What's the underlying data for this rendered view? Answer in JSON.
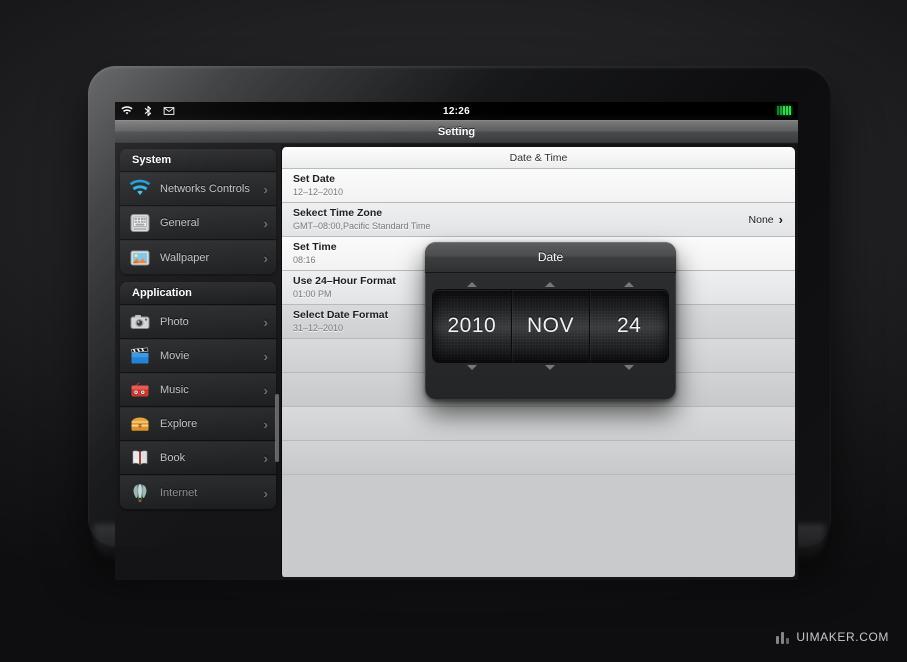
{
  "statusbar": {
    "icons": [
      "wifi-icon",
      "bluetooth-icon",
      "mail-icon"
    ],
    "time": "12:26",
    "battery_bars": 5
  },
  "titlebar": {
    "title": "Setting"
  },
  "sidebar": {
    "groups": [
      {
        "header": "System",
        "items": [
          {
            "label": "Networks Controls",
            "icon": "wifi-icon",
            "chevron": "›",
            "selected": false,
            "dim": false
          },
          {
            "label": "General",
            "icon": "general-settings-icon",
            "chevron": "›",
            "selected": true,
            "dim": false
          },
          {
            "label": "Wallpaper",
            "icon": "wallpaper-picture-icon",
            "chevron": "›",
            "selected": false,
            "dim": false
          }
        ]
      },
      {
        "header": "Application",
        "items": [
          {
            "label": "Photo",
            "icon": "camera-icon",
            "chevron": "›",
            "selected": false,
            "dim": false
          },
          {
            "label": "Movie",
            "icon": "clapperboard-icon",
            "chevron": "›",
            "selected": false,
            "dim": false
          },
          {
            "label": "Music",
            "icon": "radio-icon",
            "chevron": "›",
            "selected": false,
            "dim": false
          },
          {
            "label": "Explore",
            "icon": "treasure-chest-icon",
            "chevron": "›",
            "selected": false,
            "dim": false
          },
          {
            "label": "Book",
            "icon": "open-book-icon",
            "chevron": "›",
            "selected": false,
            "dim": false
          },
          {
            "label": "Internet",
            "icon": "hot-air-balloon-icon",
            "chevron": "›",
            "selected": false,
            "dim": true
          }
        ]
      }
    ]
  },
  "content": {
    "header": "Date & Time",
    "rows": [
      {
        "title": "Set Date",
        "subtitle": "12–12–2010",
        "value": "",
        "chevron": ""
      },
      {
        "title": "Sekect Time Zone",
        "subtitle": "GMT–08:00,Pacific Standard Time",
        "value": "None",
        "chevron": "›"
      },
      {
        "title": "Set Time",
        "subtitle": "08:16",
        "value": "",
        "chevron": ""
      },
      {
        "title": "Use 24–Hour Format",
        "subtitle": "01:00 PM",
        "value": "",
        "chevron": ""
      },
      {
        "title": "Select Date Format",
        "subtitle": "31–12–2010",
        "value": "",
        "chevron": ""
      }
    ],
    "empty_row_count": 4
  },
  "picker": {
    "title": "Date",
    "columns": [
      {
        "name": "year",
        "value": "2010",
        "up": "▲",
        "down": "▼"
      },
      {
        "name": "month",
        "value": "NOV",
        "up": "▲",
        "down": "▼"
      },
      {
        "name": "day",
        "value": "24",
        "up": "▲",
        "down": "▼"
      }
    ]
  },
  "watermark": {
    "text": "UIMAKER.COM"
  },
  "colors": {
    "accent_wifi": "#29b6f0",
    "battery_green": "#2fd94a",
    "selection_pointer": "#ffffff",
    "content_bg": "#c9cacc",
    "device_bezel": "#17181a"
  }
}
